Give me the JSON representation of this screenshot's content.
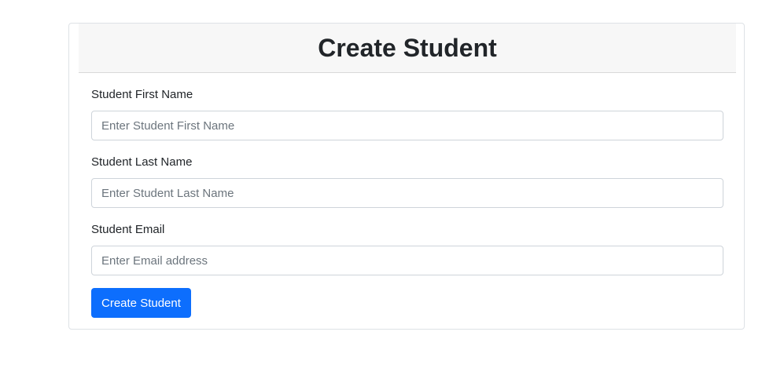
{
  "header": {
    "title": "Create Student"
  },
  "form": {
    "first_name": {
      "label": "Student First Name",
      "placeholder": "Enter Student First Name",
      "value": ""
    },
    "last_name": {
      "label": "Student Last Name",
      "placeholder": "Enter Student Last Name",
      "value": ""
    },
    "email": {
      "label": "Student Email",
      "placeholder": "Enter Email address",
      "value": ""
    },
    "submit_label": "Create Student"
  },
  "colors": {
    "primary": "#0d6efd",
    "header_bg": "#f7f7f7",
    "border": "#dee2e6"
  }
}
